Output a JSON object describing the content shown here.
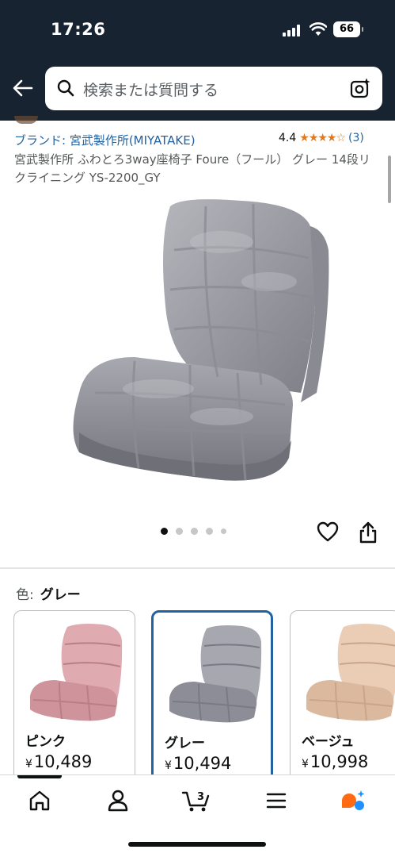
{
  "status_bar": {
    "time": "17:26",
    "battery": "66"
  },
  "search": {
    "placeholder": "検索または質問する"
  },
  "product": {
    "brand": "ブランド: 宮武製作所(MIYATAKE)",
    "rating_value": "4.4",
    "rating_stars": 4.4,
    "rating_count": "(3)",
    "title": "宮武製作所 ふわとろ3way座椅子 Foure（フール） グレー 14段リクライニング YS-2200_GY",
    "image_count": 5,
    "active_image": 1
  },
  "variation": {
    "label": "色:",
    "selected": "グレー",
    "options": [
      {
        "name": "ピンク",
        "yen": "¥",
        "price": "10,489",
        "color": "#d9a1a9"
      },
      {
        "name": "グレー",
        "yen": "¥",
        "price": "10,494",
        "color": "#9a9aa3"
      },
      {
        "name": "ベージュ",
        "yen": "¥",
        "price": "10,998",
        "color": "#e3c2a8"
      }
    ]
  },
  "bottom_nav": {
    "cart_count": "3",
    "items": [
      "home-icon",
      "account-icon",
      "cart-icon",
      "menu-icon",
      "rufus-icon"
    ]
  },
  "colors": {
    "header_bg": "#172330",
    "link": "#2162a1",
    "star": "#de7921",
    "selected_border": "#2162a1"
  }
}
